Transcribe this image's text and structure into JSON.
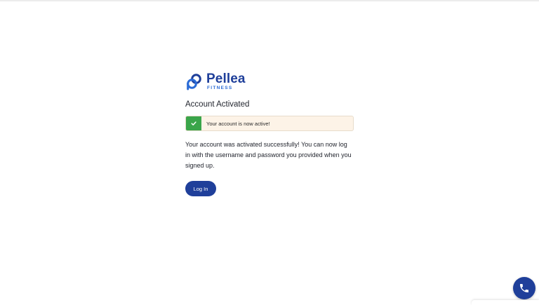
{
  "brand": {
    "name": "Pellea",
    "subtitle": "FITNESS",
    "color": "#1f3f9a",
    "accent": "#2a6bd6",
    "logo_icon": "pellea-logo-icon"
  },
  "page": {
    "title": "Account Activated"
  },
  "alert": {
    "text": "Your account is now active!",
    "icon": "check-icon",
    "status_color": "#3aa54a",
    "background": "#fdf3e7"
  },
  "message": {
    "text": "Your account was activated successfully! You can now log in with the username and password you provided when you signed up."
  },
  "actions": {
    "login_label": "Log In"
  },
  "floating": {
    "call_icon": "phone-icon"
  }
}
